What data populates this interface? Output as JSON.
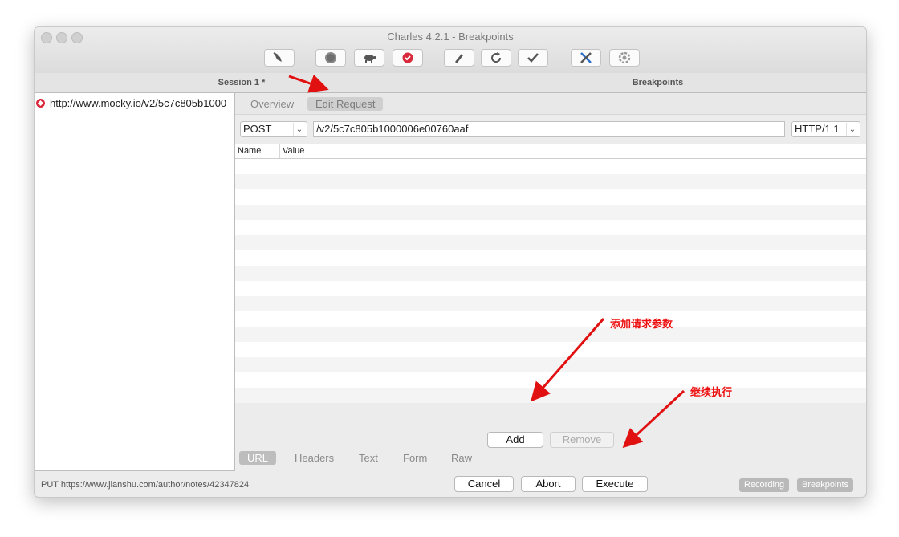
{
  "window": {
    "title": "Charles 4.2.1 - Breakpoints"
  },
  "toolbar": {
    "icons": [
      "broom-icon",
      "record-icon",
      "turtle-icon",
      "breakpoint-icon",
      "pen-icon",
      "refresh-icon",
      "check-icon",
      "tools-icon",
      "gear-icon"
    ]
  },
  "tabs": {
    "session": "Session 1 *",
    "breakpoints": "Breakpoints"
  },
  "session_tree": {
    "item": "http://www.mocky.io/v2/5c7c805b1000"
  },
  "subtabs": {
    "overview": "Overview",
    "edit_request": "Edit Request"
  },
  "request": {
    "method": "POST",
    "path": "/v2/5c7c805b1000006e00760aaf",
    "protocol": "HTTP/1.1"
  },
  "params_table": {
    "col_name": "Name",
    "col_value": "Value"
  },
  "param_buttons": {
    "add": "Add",
    "remove": "Remove"
  },
  "bottom_tabs": {
    "url": "URL",
    "headers": "Headers",
    "text": "Text",
    "form": "Form",
    "raw": "Raw"
  },
  "actions": {
    "cancel": "Cancel",
    "abort": "Abort",
    "execute": "Execute"
  },
  "statusbar": {
    "text": "PUT https://www.jianshu.com/author/notes/42347824",
    "recording": "Recording",
    "breakpoints": "Breakpoints"
  },
  "annotations": {
    "add_params": "添加请求参数",
    "continue": "继续执行"
  },
  "colors": {
    "annotation_red": "#e11111",
    "breakpoint_red": "#d9283a"
  }
}
